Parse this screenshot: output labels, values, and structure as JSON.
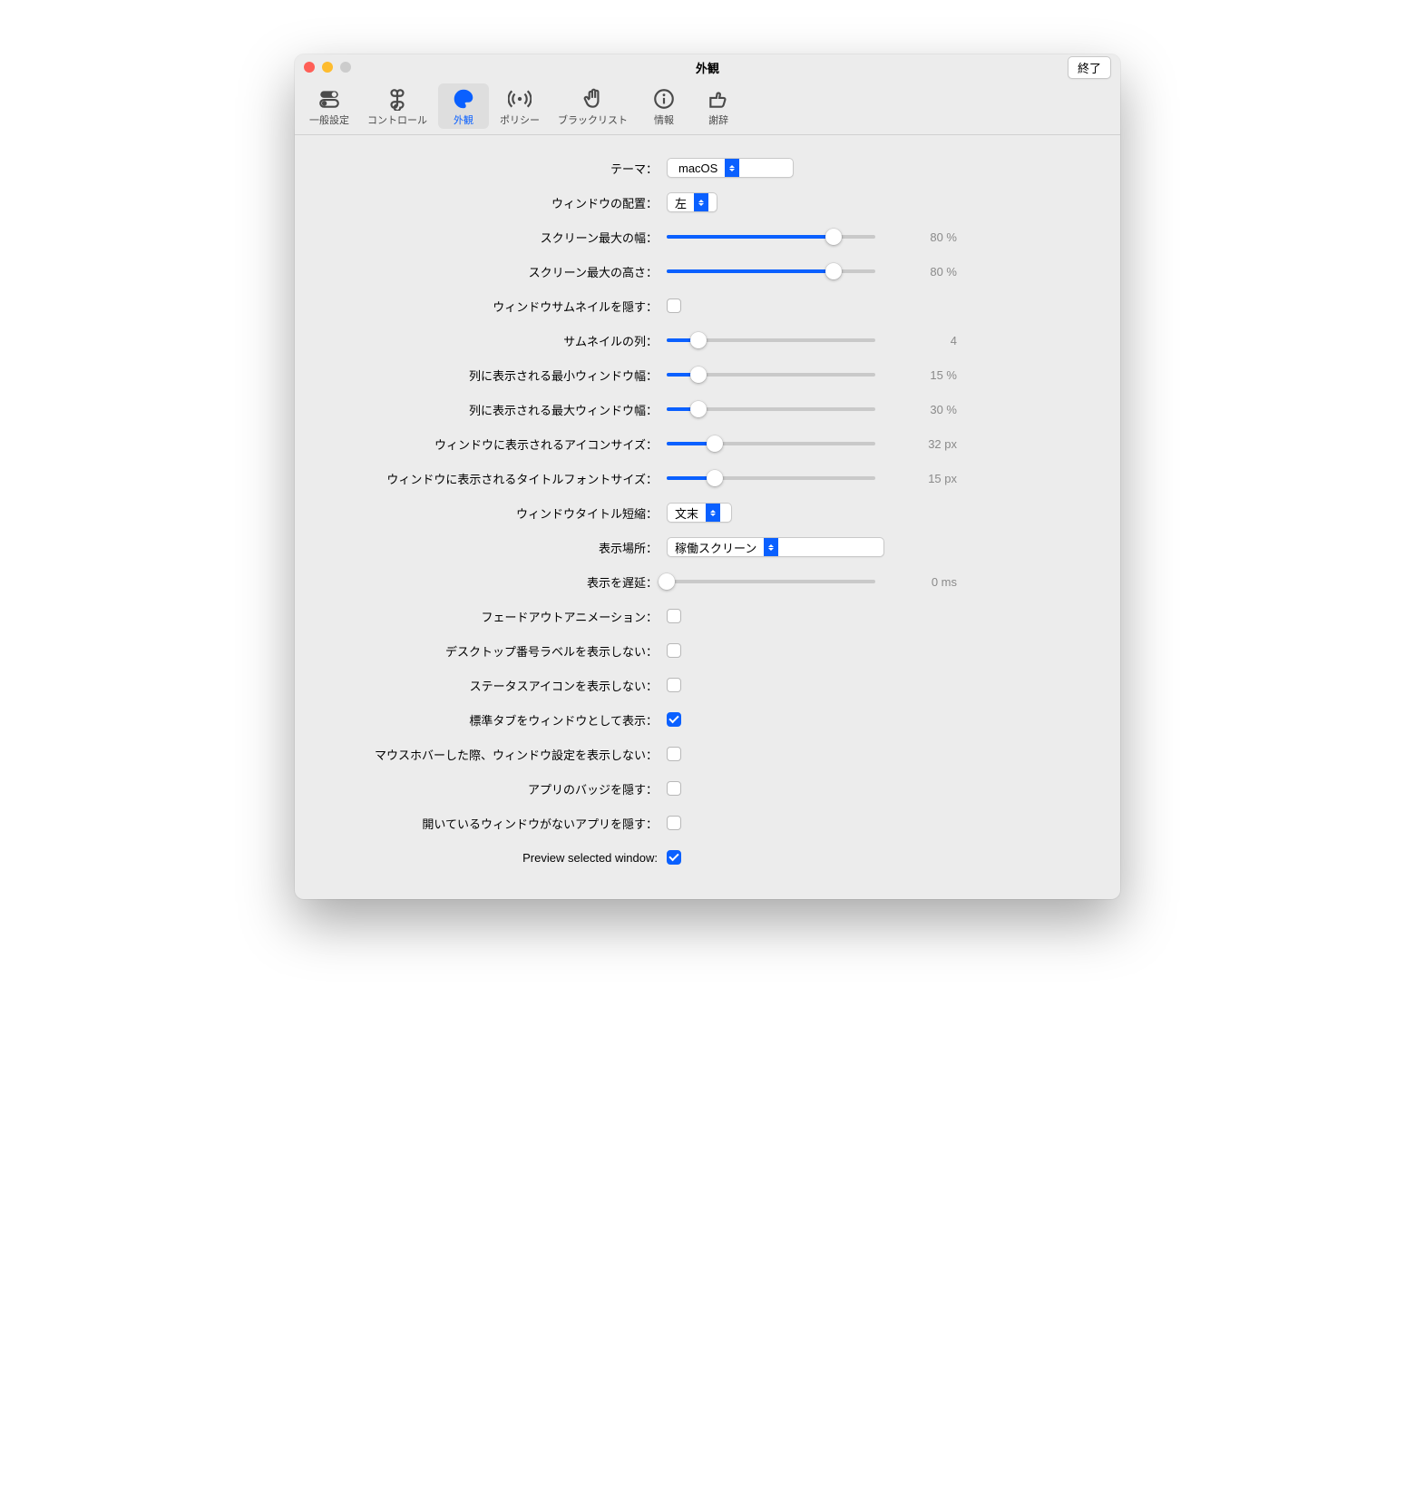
{
  "window": {
    "title": "外観",
    "quit": "終了"
  },
  "toolbar": [
    {
      "id": "general",
      "label": "一般設定"
    },
    {
      "id": "controls",
      "label": "コントロール"
    },
    {
      "id": "appearance",
      "label": "外観",
      "active": true
    },
    {
      "id": "policy",
      "label": "ポリシー"
    },
    {
      "id": "blacklist",
      "label": "ブラックリスト"
    },
    {
      "id": "info",
      "label": "情報"
    },
    {
      "id": "ack",
      "label": "謝辞"
    }
  ],
  "rows": {
    "theme": {
      "label": "テーマ：",
      "value": "macOS"
    },
    "alignment": {
      "label": "ウィンドウの配置：",
      "value": "左"
    },
    "maxWidth": {
      "label": "スクリーン最大の幅：",
      "value": "80 %",
      "pct": 80
    },
    "maxHeight": {
      "label": "スクリーン最大の高さ：",
      "value": "80 %",
      "pct": 80
    },
    "hideThumb": {
      "label": "ウィンドウサムネイルを隠す：",
      "checked": false
    },
    "thumbCols": {
      "label": "サムネイルの列：",
      "value": "4",
      "pct": 15
    },
    "minWinWidth": {
      "label": "列に表示される最小ウィンドウ幅：",
      "value": "15 %",
      "pct": 15
    },
    "maxWinWidth": {
      "label": "列に表示される最大ウィンドウ幅：",
      "value": "30 %",
      "pct": 15
    },
    "iconSize": {
      "label": "ウィンドウに表示されるアイコンサイズ：",
      "value": "32 px",
      "pct": 23
    },
    "fontSize": {
      "label": "ウィンドウに表示されるタイトルフォントサイズ：",
      "value": "15 px",
      "pct": 23
    },
    "titleTrunc": {
      "label": "ウィンドウタイトル短縮：",
      "value": "文末"
    },
    "showOn": {
      "label": "表示場所：",
      "value": "稼働スクリーン"
    },
    "delay": {
      "label": "表示を遅延：",
      "value": "0 ms",
      "pct": 0
    },
    "fadeOut": {
      "label": "フェードアウトアニメーション：",
      "checked": false
    },
    "hideDesktopLabel": {
      "label": "デスクトップ番号ラベルを表示しない：",
      "checked": false
    },
    "hideStatusIcon": {
      "label": "ステータスアイコンを表示しない：",
      "checked": false
    },
    "tabsAsWindows": {
      "label": "標準タブをウィンドウとして表示：",
      "checked": true
    },
    "hideSettingsHover": {
      "label": "マウスホバーした際、ウィンドウ設定を表示しない：",
      "checked": false
    },
    "hideAppBadge": {
      "label": "アプリのバッジを隠す：",
      "checked": false
    },
    "hideNoWindowApp": {
      "label": "開いているウィンドウがないアプリを隠す：",
      "checked": false
    },
    "previewSelected": {
      "label": "Preview selected window:",
      "checked": true
    }
  }
}
